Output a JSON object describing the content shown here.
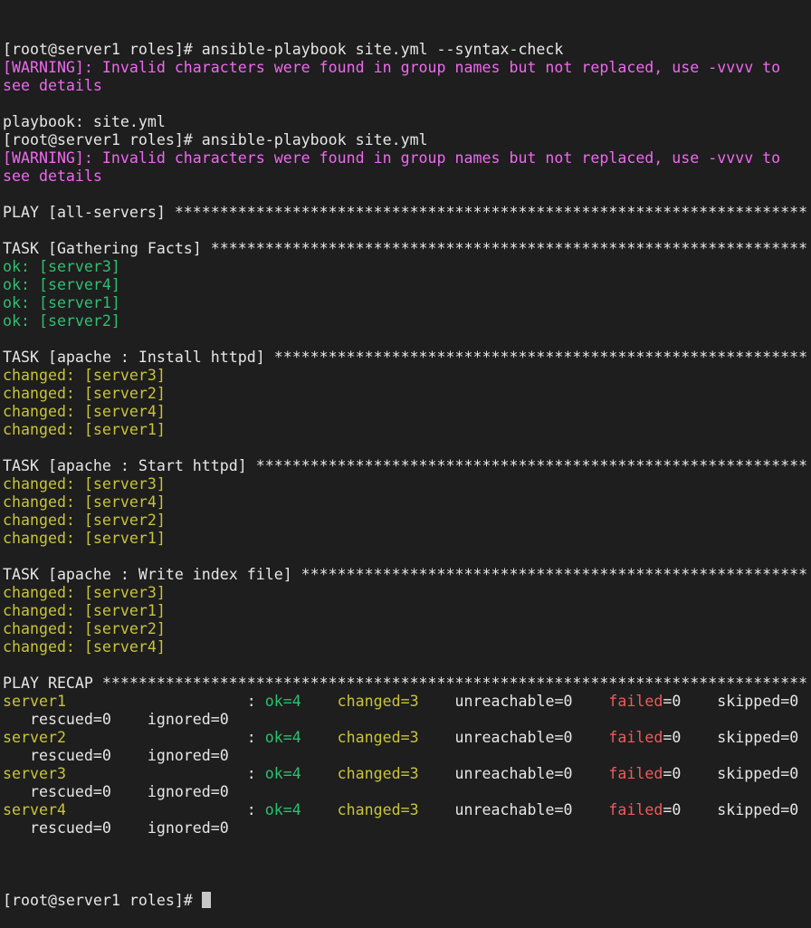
{
  "colors": {
    "background": "#1e1e1e",
    "default": "#e6e6e6",
    "warning": "#ef68ef",
    "ok": "#2fbf71",
    "changed": "#c8c43a",
    "failed": "#ef5a5a"
  },
  "lines": [
    [
      {
        "t": "[root@server1 roles]# ansible-playbook site.yml --syntax-check",
        "c": "default"
      }
    ],
    [
      {
        "t": "[WARNING]: Invalid characters were found in group names but not replaced, use -vvvv to",
        "c": "warn"
      }
    ],
    [
      {
        "t": "see details",
        "c": "warn"
      }
    ],
    [],
    [
      {
        "t": "playbook: site.yml",
        "c": "default"
      }
    ],
    [
      {
        "t": "[root@server1 roles]# ansible-playbook site.yml",
        "c": "default"
      }
    ],
    [
      {
        "t": "[WARNING]: Invalid characters were found in group names but not replaced, use -vvvv to",
        "c": "warn"
      }
    ],
    [
      {
        "t": "see details",
        "c": "warn"
      }
    ],
    [],
    [
      {
        "t": "PLAY [all-servers] **********************************************************************",
        "c": "default"
      }
    ],
    [],
    [
      {
        "t": "TASK [Gathering Facts] ******************************************************************",
        "c": "default"
      }
    ],
    [
      {
        "t": "ok: [server3]",
        "c": "ok"
      }
    ],
    [
      {
        "t": "ok: [server4]",
        "c": "ok"
      }
    ],
    [
      {
        "t": "ok: [server1]",
        "c": "ok"
      }
    ],
    [
      {
        "t": "ok: [server2]",
        "c": "ok"
      }
    ],
    [],
    [
      {
        "t": "TASK [apache : Install httpd] ***********************************************************",
        "c": "default"
      }
    ],
    [
      {
        "t": "changed: [server3]",
        "c": "changed"
      }
    ],
    [
      {
        "t": "changed: [server2]",
        "c": "changed"
      }
    ],
    [
      {
        "t": "changed: [server4]",
        "c": "changed"
      }
    ],
    [
      {
        "t": "changed: [server1]",
        "c": "changed"
      }
    ],
    [],
    [
      {
        "t": "TASK [apache : Start httpd] *************************************************************",
        "c": "default"
      }
    ],
    [
      {
        "t": "changed: [server3]",
        "c": "changed"
      }
    ],
    [
      {
        "t": "changed: [server4]",
        "c": "changed"
      }
    ],
    [
      {
        "t": "changed: [server2]",
        "c": "changed"
      }
    ],
    [
      {
        "t": "changed: [server1]",
        "c": "changed"
      }
    ],
    [],
    [
      {
        "t": "TASK [apache : Write index file] ********************************************************",
        "c": "default"
      }
    ],
    [
      {
        "t": "changed: [server3]",
        "c": "changed"
      }
    ],
    [
      {
        "t": "changed: [server1]",
        "c": "changed"
      }
    ],
    [
      {
        "t": "changed: [server2]",
        "c": "changed"
      }
    ],
    [
      {
        "t": "changed: [server4]",
        "c": "changed"
      }
    ],
    [],
    [
      {
        "t": "PLAY RECAP ******************************************************************************",
        "c": "default"
      }
    ],
    [
      {
        "t": "server1",
        "c": "changed"
      },
      {
        "t": "                    : ",
        "c": "default"
      },
      {
        "t": "ok=4",
        "c": "ok"
      },
      {
        "t": "    ",
        "c": "default"
      },
      {
        "t": "changed=3",
        "c": "changed"
      },
      {
        "t": "    unreachable=0    ",
        "c": "default"
      },
      {
        "t": "failed",
        "c": "failed"
      },
      {
        "t": "=0    skipped=0",
        "c": "default"
      }
    ],
    [
      {
        "t": "   rescued=0    ignored=0",
        "c": "default"
      }
    ],
    [
      {
        "t": "server2",
        "c": "changed"
      },
      {
        "t": "                    : ",
        "c": "default"
      },
      {
        "t": "ok=4",
        "c": "ok"
      },
      {
        "t": "    ",
        "c": "default"
      },
      {
        "t": "changed=3",
        "c": "changed"
      },
      {
        "t": "    unreachable=0    ",
        "c": "default"
      },
      {
        "t": "failed",
        "c": "failed"
      },
      {
        "t": "=0    skipped=0",
        "c": "default"
      }
    ],
    [
      {
        "t": "   rescued=0    ignored=0",
        "c": "default"
      }
    ],
    [
      {
        "t": "server3",
        "c": "changed"
      },
      {
        "t": "                    : ",
        "c": "default"
      },
      {
        "t": "ok=4",
        "c": "ok"
      },
      {
        "t": "    ",
        "c": "default"
      },
      {
        "t": "changed=3",
        "c": "changed"
      },
      {
        "t": "    unreachable=0    ",
        "c": "default"
      },
      {
        "t": "failed",
        "c": "failed"
      },
      {
        "t": "=0    skipped=0",
        "c": "default"
      }
    ],
    [
      {
        "t": "   rescued=0    ignored=0",
        "c": "default"
      }
    ],
    [
      {
        "t": "server4",
        "c": "changed"
      },
      {
        "t": "                    : ",
        "c": "default"
      },
      {
        "t": "ok=4",
        "c": "ok"
      },
      {
        "t": "    ",
        "c": "default"
      },
      {
        "t": "changed=3",
        "c": "changed"
      },
      {
        "t": "    unreachable=0    ",
        "c": "default"
      },
      {
        "t": "failed",
        "c": "failed"
      },
      {
        "t": "=0    skipped=0",
        "c": "default"
      }
    ],
    [
      {
        "t": "   rescued=0    ignored=0",
        "c": "default"
      }
    ],
    []
  ],
  "prompt": "[root@server1 roles]# ",
  "cursor_icon": "block-cursor-icon"
}
